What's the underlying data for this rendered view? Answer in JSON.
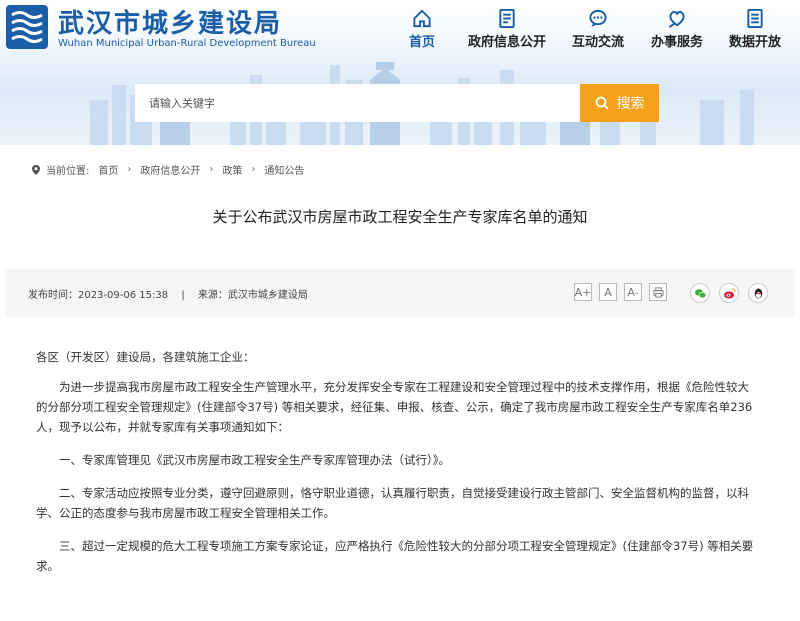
{
  "site": {
    "title": "武汉市城乡建设局",
    "subtitle": "Wuhan Municipal Urban-Rural Development Bureau"
  },
  "nav": [
    {
      "label": "首页",
      "icon": "home-icon",
      "active": true
    },
    {
      "label": "政府信息公开",
      "icon": "document-icon"
    },
    {
      "label": "互动交流",
      "icon": "chat-icon"
    },
    {
      "label": "办事服务",
      "icon": "heart-hand-icon"
    },
    {
      "label": "数据开放",
      "icon": "data-icon"
    }
  ],
  "search": {
    "placeholder": "请输入关键字",
    "button_label": "搜索"
  },
  "breadcrumb": {
    "prefix": "当前位置:",
    "items": [
      "首页",
      "政府信息公开",
      "政策",
      "通知公告"
    ]
  },
  "article": {
    "title": "关于公布武汉市房屋市政工程安全生产专家库名单的通知",
    "publish_time": "发布时间：2023-09-06 15:38",
    "source": "来源：武汉市城乡建设局",
    "separator": "|",
    "font_buttons": [
      "A+",
      "A",
      "A-"
    ],
    "paragraphs": [
      "各区（开发区）建设局，各建筑施工企业：",
      "为进一步提高我市房屋市政工程安全生产管理水平，充分发挥安全专家在工程建设和安全管理过程中的技术支撑作用，根据《危险性较大的分部分项工程安全管理规定》(住建部令37号) 等相关要求，经征集、申报、核查、公示，确定了我市房屋市政工程安全生产专家库名单236人，现予以公布，并就专家库有关事项通知如下：",
      "一、专家库管理见《武汉市房屋市政工程安全生产专家库管理办法（试行）》。",
      "二、专家活动应按照专业分类，遵守回避原则，恪守职业道德，认真履行职责，自觉接受建设行政主管部门、安全监督机构的监督，以科学、公正的态度参与我市房屋市政工程安全管理相关工作。",
      "三、超过一定规模的危大工程专项施工方案专家论证，应严格执行《危险性较大的分部分项工程安全管理规定》(住建部令37号) 等相关要求。"
    ]
  },
  "colors": {
    "brand": "#1a5ea8",
    "search_button": "#f5a11a",
    "wechat": "#3cb034",
    "weibo": "#e6162d"
  }
}
